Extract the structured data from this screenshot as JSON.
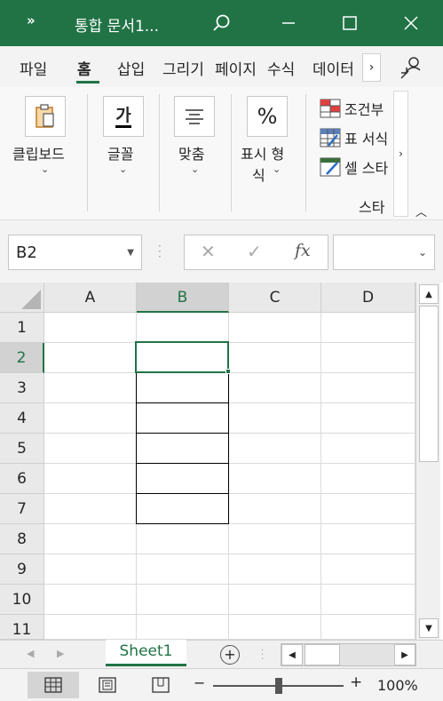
{
  "titlebar": {
    "overflow_label": "»",
    "title": "통합 문서1...",
    "search_icon": "search-icon",
    "minimize_icon": "minimize-icon",
    "maximize_icon": "maximize-icon",
    "close_icon": "close-icon"
  },
  "tabs": {
    "items": [
      "파일",
      "홈",
      "삽입",
      "그리기",
      "페이지",
      "수식",
      "데이터"
    ],
    "active": "홈",
    "more": "›"
  },
  "ribbon": {
    "clipboard": {
      "label": "클립보드",
      "chevron": "⌄"
    },
    "font": {
      "label": "글꼴",
      "chevron": "⌄",
      "glyph": "가"
    },
    "alignment": {
      "label": "맞춤",
      "chevron": "⌄"
    },
    "number": {
      "label_line1": "표시 형",
      "label_line2": "식",
      "chevron": "⌄",
      "glyph": "%"
    },
    "styles": {
      "items": [
        "조건부",
        "표 서식",
        "셀 스타"
      ],
      "group_label": "스타"
    },
    "scroll_right": "›",
    "collapse": "︿"
  },
  "formula_bar": {
    "name_box": "B2",
    "name_dropdown": "▼",
    "cancel": "✕",
    "confirm": "✓",
    "fx": "fx",
    "formula_value": "",
    "formula_dropdown": "⌄"
  },
  "grid": {
    "columns": [
      "A",
      "B",
      "C",
      "D"
    ],
    "rows": [
      "1",
      "2",
      "3",
      "4",
      "5",
      "6",
      "7",
      "8",
      "9",
      "10",
      "11"
    ],
    "active_cell": "B2",
    "scroll_up": "▲",
    "scroll_down": "▼"
  },
  "sheets": {
    "tabs": [
      "Sheet1"
    ],
    "add": "+",
    "prev": "◀",
    "next": "▶"
  },
  "statusbar": {
    "zoom_minus": "−",
    "zoom_plus": "+",
    "zoom": "100%",
    "zoom_level_fraction": 0.5
  },
  "colors": {
    "brand": "#217346",
    "border": "#000000"
  }
}
